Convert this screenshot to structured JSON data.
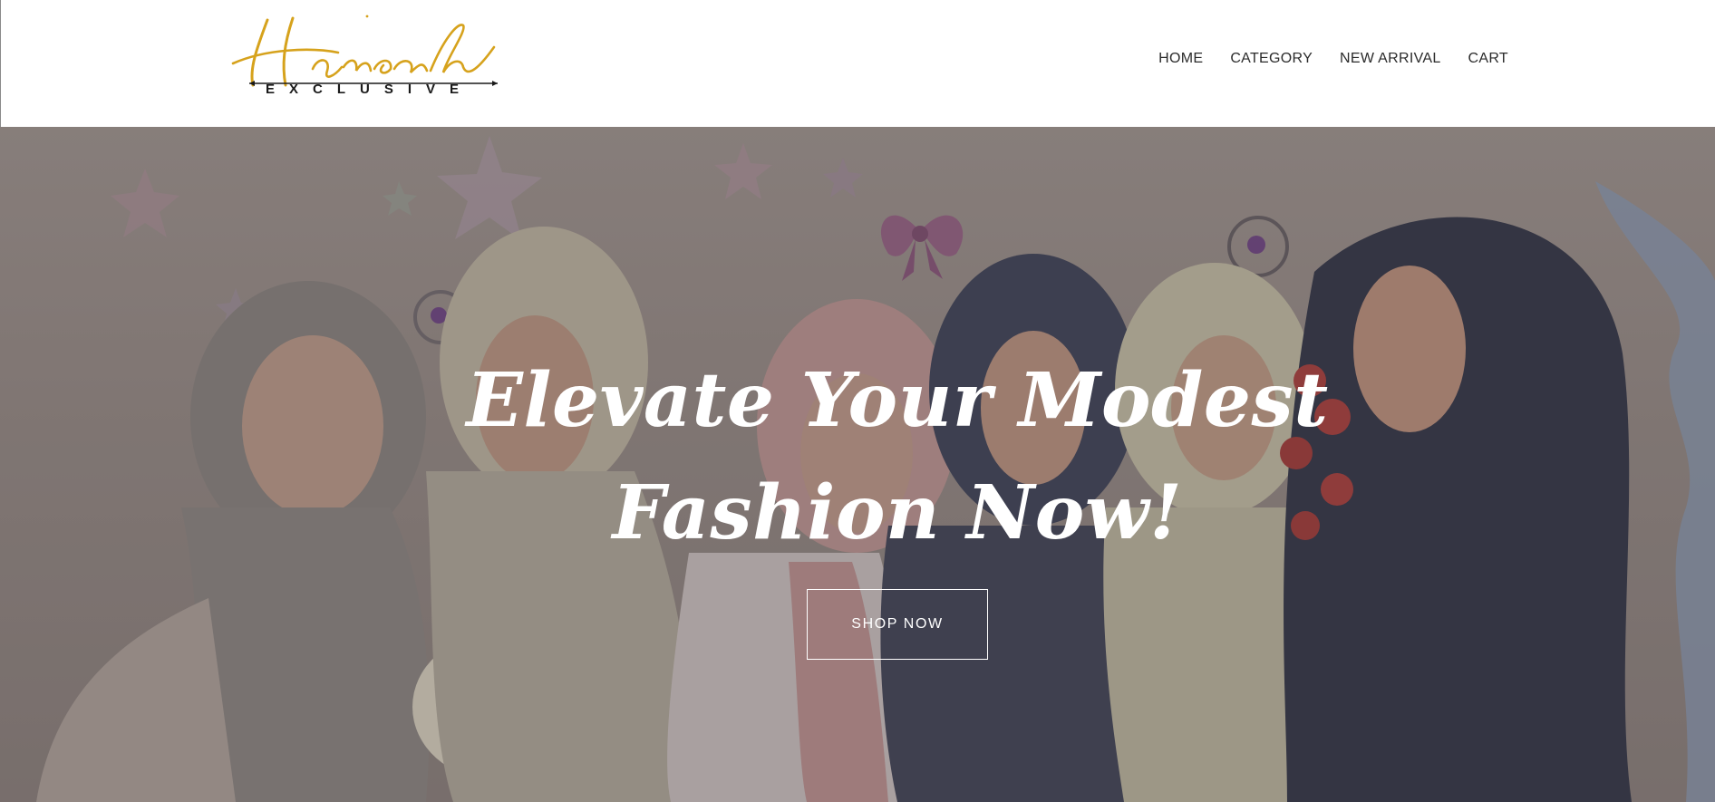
{
  "brand": {
    "script": "Hameah",
    "sub": "EXCLUSIVE",
    "gold": "#d6a21c"
  },
  "nav": {
    "items": [
      {
        "label": "HOME"
      },
      {
        "label": "CATEGORY"
      },
      {
        "label": "NEW ARRIVAL"
      },
      {
        "label": "CART"
      }
    ]
  },
  "hero": {
    "headline_line1": "Elevate Your Modest",
    "headline_line2": "Fashion Now!",
    "cta_label": "SHOP NOW"
  }
}
